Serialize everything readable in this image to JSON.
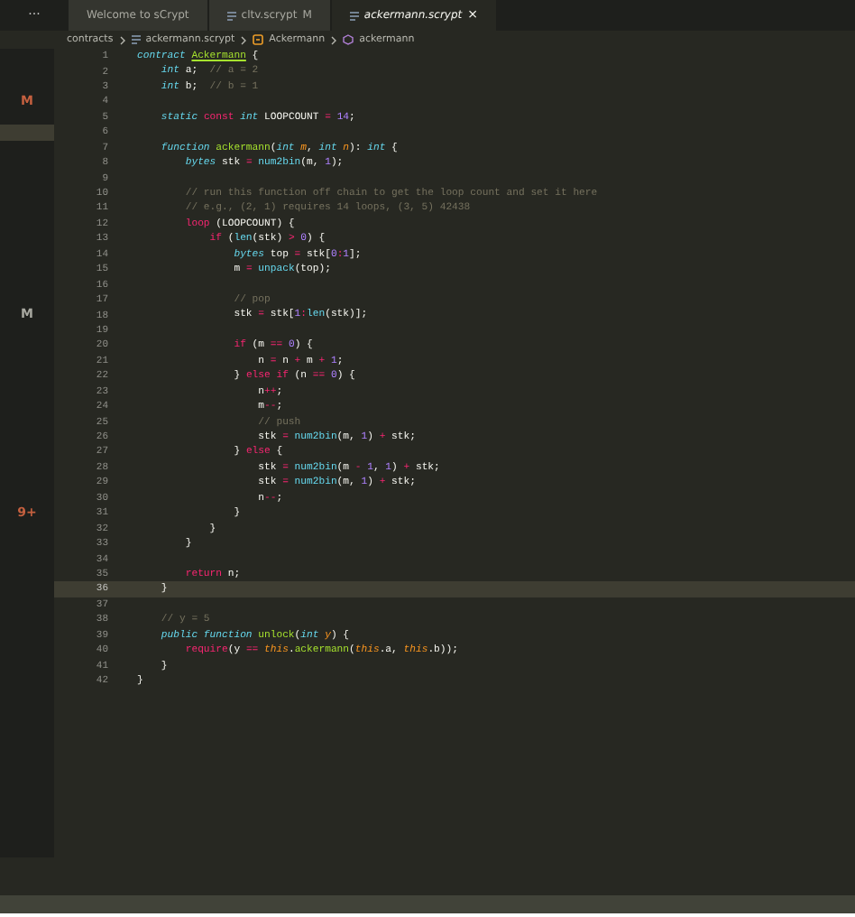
{
  "tabs_overflow": "···",
  "tabs": [
    {
      "label": "Welcome to sCrypt",
      "selected": false,
      "icon": false
    },
    {
      "label": "cltv.scrypt",
      "badge": "M",
      "selected": false,
      "icon": true
    },
    {
      "label": "ackermann.scrypt",
      "close": "×",
      "selected": true,
      "icon": true
    }
  ],
  "breadcrumb": [
    {
      "label": "contracts",
      "kind": "folder"
    },
    {
      "label": "ackermann.scrypt",
      "kind": "file"
    },
    {
      "label": "Ackermann",
      "kind": "class"
    },
    {
      "label": "ackermann",
      "kind": "method"
    }
  ],
  "sidebar": {
    "items": [
      {
        "badge": "M",
        "color": "#c5603f",
        "selected": false
      },
      {
        "selected": true
      },
      {
        "badge": "M",
        "color": "#a8a8a0",
        "selected": false
      },
      {
        "badge": "9+",
        "color": "#c5603f",
        "selected": false
      }
    ]
  },
  "editor": {
    "lines": [
      {
        "n": "1",
        "tokens": [
          {
            "text": "contract ",
            "kind": "st"
          },
          {
            "text": "Ackermann",
            "kind": "cls"
          },
          {
            "text": " {",
            "kind": "p"
          }
        ]
      },
      {
        "n": "2",
        "tokens": [
          {
            "text": "    int",
            "kind": "st"
          },
          {
            "text": " a;  ",
            "kind": "p"
          },
          {
            "text": "// a = 2",
            "kind": "cm"
          }
        ]
      },
      {
        "n": "3",
        "tokens": [
          {
            "text": "    int",
            "kind": "st"
          },
          {
            "text": " b;  ",
            "kind": "p"
          },
          {
            "text": "// b = 1",
            "kind": "cm"
          }
        ]
      },
      {
        "n": "4"
      },
      {
        "n": "5",
        "tokens": [
          {
            "text": "    static ",
            "kind": "st"
          },
          {
            "text": "const ",
            "kind": "kw"
          },
          {
            "text": "int",
            "kind": "st"
          },
          {
            "text": " LOOPCOUNT ",
            "kind": "p"
          },
          {
            "text": "= ",
            "kind": "kw"
          },
          {
            "text": "14",
            "kind": "num"
          },
          {
            "text": ";",
            "kind": "p"
          }
        ]
      },
      {
        "n": "6"
      },
      {
        "n": "7",
        "tokens": [
          {
            "text": "    function ",
            "kind": "st"
          },
          {
            "text": "ackermann",
            "kind": "fn"
          },
          {
            "text": "(",
            "kind": "p"
          },
          {
            "text": "int ",
            "kind": "st"
          },
          {
            "text": "m",
            "kind": "par"
          },
          {
            "text": ", ",
            "kind": "p"
          },
          {
            "text": "int ",
            "kind": "st"
          },
          {
            "text": "n",
            "kind": "par"
          },
          {
            "text": "): ",
            "kind": "p"
          },
          {
            "text": "int",
            "kind": "st"
          },
          {
            "text": " {",
            "kind": "p"
          }
        ]
      },
      {
        "n": "8",
        "tokens": [
          {
            "text": "        bytes",
            "kind": "st"
          },
          {
            "text": " stk ",
            "kind": "p"
          },
          {
            "text": "= ",
            "kind": "kw"
          },
          {
            "text": "num2bin",
            "kind": "bi"
          },
          {
            "text": "(m, ",
            "kind": "p"
          },
          {
            "text": "1",
            "kind": "num"
          },
          {
            "text": ");",
            "kind": "p"
          }
        ]
      },
      {
        "n": "9"
      },
      {
        "n": "10",
        "tokens": [
          {
            "text": "        // run this function off chain to get the loop count and set it here",
            "kind": "cm"
          }
        ]
      },
      {
        "n": "11",
        "tokens": [
          {
            "text": "        // e.g., (2, 1) requires 14 loops, (3, 5) 42438",
            "kind": "cm"
          }
        ]
      },
      {
        "n": "12",
        "tokens": [
          {
            "text": "        loop",
            "kind": "kw"
          },
          {
            "text": " (LOOPCOUNT) {",
            "kind": "p"
          }
        ]
      },
      {
        "n": "13",
        "tokens": [
          {
            "text": "            if",
            "kind": "kw"
          },
          {
            "text": " (",
            "kind": "p"
          },
          {
            "text": "len",
            "kind": "bi"
          },
          {
            "text": "(stk) ",
            "kind": "p"
          },
          {
            "text": "> ",
            "kind": "kw"
          },
          {
            "text": "0",
            "kind": "num"
          },
          {
            "text": ") {",
            "kind": "p"
          }
        ]
      },
      {
        "n": "14",
        "tokens": [
          {
            "text": "                bytes",
            "kind": "st"
          },
          {
            "text": " top ",
            "kind": "p"
          },
          {
            "text": "=",
            "kind": "kw"
          },
          {
            "text": " stk[",
            "kind": "p"
          },
          {
            "text": "0",
            "kind": "num"
          },
          {
            "text": ":",
            "kind": "kw"
          },
          {
            "text": "1",
            "kind": "num"
          },
          {
            "text": "];",
            "kind": "p"
          }
        ]
      },
      {
        "n": "15",
        "tokens": [
          {
            "text": "                m ",
            "kind": "p"
          },
          {
            "text": "= ",
            "kind": "kw"
          },
          {
            "text": "unpack",
            "kind": "bi"
          },
          {
            "text": "(top);",
            "kind": "p"
          }
        ]
      },
      {
        "n": "16"
      },
      {
        "n": "17",
        "tokens": [
          {
            "text": "                // pop",
            "kind": "cm"
          }
        ]
      },
      {
        "n": "18",
        "tokens": [
          {
            "text": "                stk ",
            "kind": "p"
          },
          {
            "text": "=",
            "kind": "kw"
          },
          {
            "text": " stk[",
            "kind": "p"
          },
          {
            "text": "1",
            "kind": "num"
          },
          {
            "text": ":",
            "kind": "kw"
          },
          {
            "text": "len",
            "kind": "bi"
          },
          {
            "text": "(stk)];",
            "kind": "p"
          }
        ]
      },
      {
        "n": "19"
      },
      {
        "n": "20",
        "tokens": [
          {
            "text": "                if",
            "kind": "kw"
          },
          {
            "text": " (m ",
            "kind": "p"
          },
          {
            "text": "== ",
            "kind": "kw"
          },
          {
            "text": "0",
            "kind": "num"
          },
          {
            "text": ") {",
            "kind": "p"
          }
        ]
      },
      {
        "n": "21",
        "tokens": [
          {
            "text": "                    n ",
            "kind": "p"
          },
          {
            "text": "=",
            "kind": "kw"
          },
          {
            "text": " n ",
            "kind": "p"
          },
          {
            "text": "+",
            "kind": "kw"
          },
          {
            "text": " m ",
            "kind": "p"
          },
          {
            "text": "+ ",
            "kind": "kw"
          },
          {
            "text": "1",
            "kind": "num"
          },
          {
            "text": ";",
            "kind": "p"
          }
        ]
      },
      {
        "n": "22",
        "tokens": [
          {
            "text": "                } ",
            "kind": "p"
          },
          {
            "text": "else if",
            "kind": "kw"
          },
          {
            "text": " (n ",
            "kind": "p"
          },
          {
            "text": "== ",
            "kind": "kw"
          },
          {
            "text": "0",
            "kind": "num"
          },
          {
            "text": ") {",
            "kind": "p"
          }
        ]
      },
      {
        "n": "23",
        "tokens": [
          {
            "text": "                    n",
            "kind": "p"
          },
          {
            "text": "++",
            "kind": "kw"
          },
          {
            "text": ";",
            "kind": "p"
          }
        ]
      },
      {
        "n": "24",
        "tokens": [
          {
            "text": "                    m",
            "kind": "p"
          },
          {
            "text": "--",
            "kind": "kw"
          },
          {
            "text": ";",
            "kind": "p"
          }
        ]
      },
      {
        "n": "25",
        "tokens": [
          {
            "text": "                    // push",
            "kind": "cm"
          }
        ]
      },
      {
        "n": "26",
        "tokens": [
          {
            "text": "                    stk ",
            "kind": "p"
          },
          {
            "text": "= ",
            "kind": "kw"
          },
          {
            "text": "num2bin",
            "kind": "bi"
          },
          {
            "text": "(m, ",
            "kind": "p"
          },
          {
            "text": "1",
            "kind": "num"
          },
          {
            "text": ") ",
            "kind": "p"
          },
          {
            "text": "+",
            "kind": "kw"
          },
          {
            "text": " stk;",
            "kind": "p"
          }
        ]
      },
      {
        "n": "27",
        "tokens": [
          {
            "text": "                } ",
            "kind": "p"
          },
          {
            "text": "else",
            "kind": "kw"
          },
          {
            "text": " {",
            "kind": "p"
          }
        ]
      },
      {
        "n": "28",
        "tokens": [
          {
            "text": "                    stk ",
            "kind": "p"
          },
          {
            "text": "= ",
            "kind": "kw"
          },
          {
            "text": "num2bin",
            "kind": "bi"
          },
          {
            "text": "(m ",
            "kind": "p"
          },
          {
            "text": "- ",
            "kind": "kw"
          },
          {
            "text": "1",
            "kind": "num"
          },
          {
            "text": ", ",
            "kind": "p"
          },
          {
            "text": "1",
            "kind": "num"
          },
          {
            "text": ") ",
            "kind": "p"
          },
          {
            "text": "+",
            "kind": "kw"
          },
          {
            "text": " stk;",
            "kind": "p"
          }
        ]
      },
      {
        "n": "29",
        "tokens": [
          {
            "text": "                    stk ",
            "kind": "p"
          },
          {
            "text": "= ",
            "kind": "kw"
          },
          {
            "text": "num2bin",
            "kind": "bi"
          },
          {
            "text": "(m, ",
            "kind": "p"
          },
          {
            "text": "1",
            "kind": "num"
          },
          {
            "text": ") ",
            "kind": "p"
          },
          {
            "text": "+",
            "kind": "kw"
          },
          {
            "text": " stk;",
            "kind": "p"
          }
        ]
      },
      {
        "n": "30",
        "tokens": [
          {
            "text": "                    n",
            "kind": "p"
          },
          {
            "text": "--",
            "kind": "kw"
          },
          {
            "text": ";",
            "kind": "p"
          }
        ]
      },
      {
        "n": "31",
        "tokens": [
          {
            "text": "                }",
            "kind": "p"
          }
        ]
      },
      {
        "n": "32",
        "tokens": [
          {
            "text": "            }",
            "kind": "p"
          }
        ]
      },
      {
        "n": "33",
        "tokens": [
          {
            "text": "        }",
            "kind": "p"
          }
        ]
      },
      {
        "n": "34"
      },
      {
        "n": "35",
        "tokens": [
          {
            "text": "        return",
            "kind": "kw"
          },
          {
            "text": " n;",
            "kind": "p"
          }
        ]
      },
      {
        "n": "36",
        "tokens": [
          {
            "text": "    }",
            "kind": "p"
          }
        ],
        "selected": true
      },
      {
        "n": "37"
      },
      {
        "n": "38",
        "tokens": [
          {
            "text": "    // y = 5",
            "kind": "cm"
          }
        ]
      },
      {
        "n": "39",
        "tokens": [
          {
            "text": "    public function ",
            "kind": "st"
          },
          {
            "text": "unlock",
            "kind": "fn"
          },
          {
            "text": "(",
            "kind": "p"
          },
          {
            "text": "int ",
            "kind": "st"
          },
          {
            "text": "y",
            "kind": "par"
          },
          {
            "text": ") {",
            "kind": "p"
          }
        ]
      },
      {
        "n": "40",
        "tokens": [
          {
            "text": "        require",
            "kind": "kw"
          },
          {
            "text": "(y ",
            "kind": "p"
          },
          {
            "text": "== ",
            "kind": "kw"
          },
          {
            "text": "this",
            "kind": "par"
          },
          {
            "text": ".",
            "kind": "p"
          },
          {
            "text": "ackermann",
            "kind": "fn"
          },
          {
            "text": "(",
            "kind": "p"
          },
          {
            "text": "this",
            "kind": "par"
          },
          {
            "text": ".a, ",
            "kind": "p"
          },
          {
            "text": "this",
            "kind": "par"
          },
          {
            "text": ".b));",
            "kind": "p"
          }
        ]
      },
      {
        "n": "41",
        "tokens": [
          {
            "text": "    }",
            "kind": "p"
          }
        ]
      },
      {
        "n": "42",
        "tokens": [
          {
            "text": "}",
            "kind": "p"
          }
        ]
      }
    ]
  }
}
